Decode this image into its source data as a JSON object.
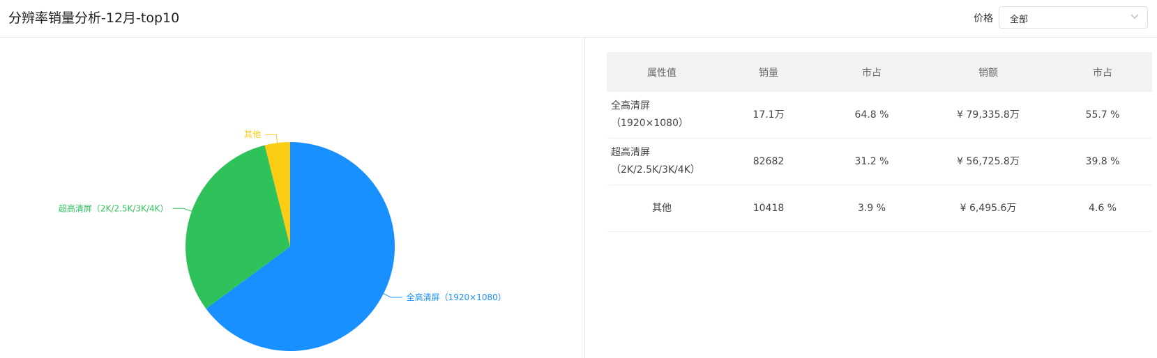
{
  "header": {
    "title": "分辨率销量分析-12月-top10",
    "price_label": "价格",
    "price_select_value": "全部"
  },
  "table": {
    "columns": [
      "属性值",
      "销量",
      "市占",
      "销额",
      "市占"
    ],
    "rows": [
      {
        "attr": "全高清屏（1920×1080）",
        "sales": "17.1万",
        "share": "64.8 %",
        "revenue": "¥ 79,335.8万",
        "revenue_share": "55.7 %"
      },
      {
        "attr": "超高清屏（2K/2.5K/3K/4K）",
        "sales": "82682",
        "share": "31.2 %",
        "revenue": "¥ 56,725.8万",
        "revenue_share": "39.8 %"
      },
      {
        "attr": "其他",
        "sales": "10418",
        "share": "3.9 %",
        "revenue": "¥ 6,495.6万",
        "revenue_share": "4.6 %"
      }
    ]
  },
  "chart_data": {
    "type": "pie",
    "slices": [
      {
        "label": "全高清屏（1920×1080）",
        "value": 64.8,
        "color": "#1890ff"
      },
      {
        "label": "超高清屏（2K/2.5K/3K/4K）",
        "value": 31.2,
        "color": "#2fc25b"
      },
      {
        "label": "其他",
        "value": 3.9,
        "color": "#facc14"
      }
    ]
  }
}
